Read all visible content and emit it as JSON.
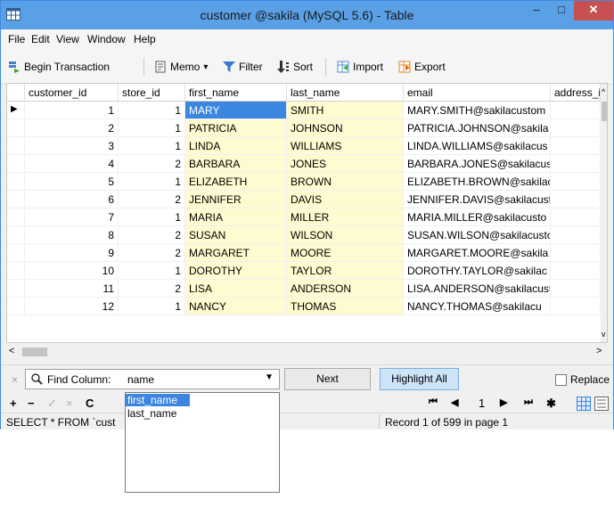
{
  "window": {
    "title": "customer @sakila (MySQL 5.6) - Table",
    "minimize": "‒",
    "maximize": "□",
    "close": "✕"
  },
  "menu": [
    "File",
    "Edit",
    "View",
    "Window",
    "Help"
  ],
  "toolbar": {
    "begin_transaction": "Begin Transaction",
    "memo": "Memo",
    "memo_caret": "▾",
    "filter": "Filter",
    "sort": "Sort",
    "import": "Import",
    "export": "Export"
  },
  "grid": {
    "columns": [
      "customer_id",
      "store_id",
      "first_name",
      "last_name",
      "email",
      "address_i"
    ],
    "scroll_up_arrow": "^",
    "scroll_down_arrow": "v",
    "row_marker": "▶",
    "rows": [
      [
        "1",
        "1",
        "MARY",
        "SMITH",
        "MARY.SMITH@sakilacustom"
      ],
      [
        "2",
        "1",
        "PATRICIA",
        "JOHNSON",
        "PATRICIA.JOHNSON@sakila"
      ],
      [
        "3",
        "1",
        "LINDA",
        "WILLIAMS",
        "LINDA.WILLIAMS@sakilacus"
      ],
      [
        "4",
        "2",
        "BARBARA",
        "JONES",
        "BARBARA.JONES@sakilacust"
      ],
      [
        "5",
        "1",
        "ELIZABETH",
        "BROWN",
        "ELIZABETH.BROWN@sakilac"
      ],
      [
        "6",
        "2",
        "JENNIFER",
        "DAVIS",
        "JENNIFER.DAVIS@sakilacust"
      ],
      [
        "7",
        "1",
        "MARIA",
        "MILLER",
        "MARIA.MILLER@sakilacusto"
      ],
      [
        "8",
        "2",
        "SUSAN",
        "WILSON",
        "SUSAN.WILSON@sakilacusto"
      ],
      [
        "9",
        "2",
        "MARGARET",
        "MOORE",
        "MARGARET.MOORE@sakila"
      ],
      [
        "10",
        "1",
        "DOROTHY",
        "TAYLOR",
        "DOROTHY.TAYLOR@sakilac"
      ],
      [
        "11",
        "2",
        "LISA",
        "ANDERSON",
        "LISA.ANDERSON@sakilacust"
      ],
      [
        "12",
        "1",
        "NANCY",
        "THOMAS",
        "NANCY.THOMAS@sakilacu"
      ]
    ]
  },
  "hscroll": {
    "left_arrow": "<",
    "right_arrow": ">"
  },
  "find": {
    "close": "×",
    "label": "Find Column:",
    "value": "name",
    "next": "Next",
    "highlight_all": "Highlight All",
    "replace": "Replace"
  },
  "dropdown": {
    "options": [
      "first_name",
      "last_name"
    ]
  },
  "nav": {
    "add": "+",
    "remove": "−",
    "apply": "✓",
    "cancel": "×",
    "refresh": "C",
    "first": "⏮",
    "prev": "◀",
    "page": "1",
    "next": "▶",
    "last": "⏭",
    "settings": "✱"
  },
  "status": {
    "sql": "SELECT * FROM `cust",
    "record": "Record 1 of 599 in page 1"
  },
  "colors": {
    "title_bar": "#5aa0e6",
    "selection": "#3a86e0",
    "highlight": "#fffbd0",
    "close": "#c75050"
  }
}
